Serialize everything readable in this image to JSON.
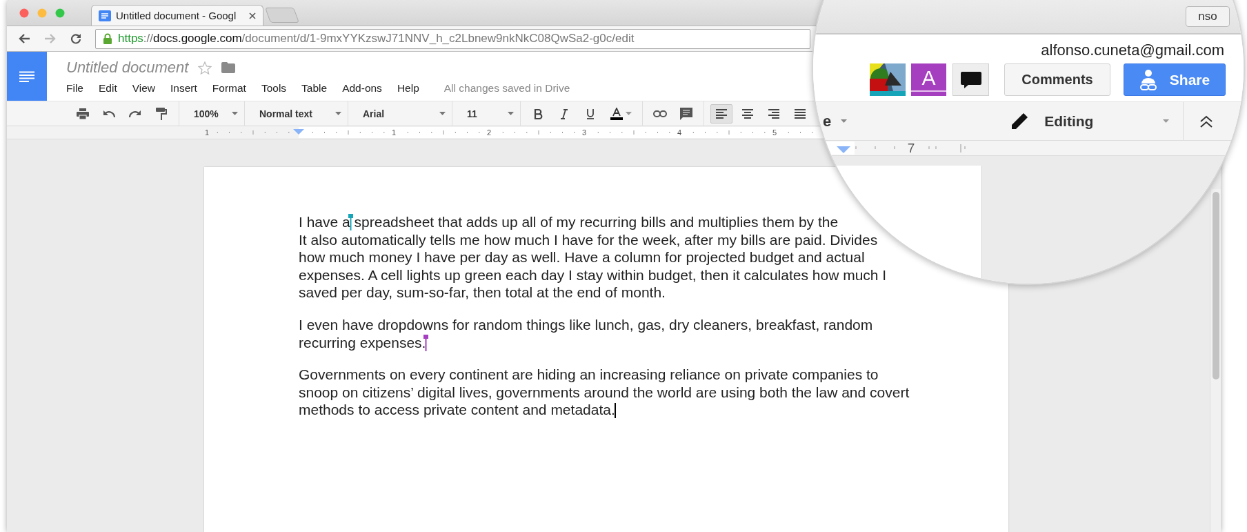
{
  "browser": {
    "tabs": [
      {
        "title": "Untitled document - Googl",
        "selected": true
      }
    ],
    "address": {
      "scheme": "https",
      "separator": "://",
      "host": "docs.google.com",
      "path": "/document/d/1-9mxYYKzswJ71NNV_h_c2Lbnew9nkNkC08QwSa2-g0c/edit"
    },
    "profile": "nso"
  },
  "docs": {
    "title": "Untitled document",
    "starred": false,
    "menu": [
      "File",
      "Edit",
      "View",
      "Insert",
      "Format",
      "Tools",
      "Table",
      "Add-ons",
      "Help"
    ],
    "save_status": "All changes saved in Drive",
    "account": "alfonso.cuneta@gmail.com",
    "collaborators": [
      {
        "kind": "photo",
        "color": "#16a5b8"
      },
      {
        "kind": "letter",
        "initial": "A",
        "color": "#a53fbf"
      }
    ],
    "comments_button": "Comments",
    "share_button": "Share"
  },
  "toolbar": {
    "zoom": "100%",
    "style": "Normal text",
    "font": "Arial",
    "size": "11",
    "alignments": [
      {
        "selected": true
      },
      {
        "selected": false
      },
      {
        "selected": false
      },
      {
        "selected": false
      }
    ],
    "partial_label": "e",
    "mode": "Editing"
  },
  "ruler": {
    "numbers": [
      "1",
      "1",
      "2",
      "3",
      "4",
      "5"
    ],
    "lens_number": "7"
  },
  "document": {
    "paragraphs": [
      {
        "runs": [
          {
            "kind": "text",
            "text": "I have a"
          },
          {
            "kind": "collaborator_cursor",
            "color": "#16a5b8"
          },
          {
            "kind": "text",
            "text": " spreadsheet that adds up all of my recurring bills and multiplies them by the\nIt also automatically tells me how much I have for the week, after my bills are paid. Divides\nhow much money I have per day as well. Have a column for projected budget and actual\nexpenses. A cell lights up green each day I stay within budget, then it calculates how much I\nsaved per day, sum-so-far, then total at the end of month."
          }
        ]
      },
      {
        "runs": [
          {
            "kind": "text",
            "text": "I even have dropdowns for random things like lunch, gas, dry cleaners, breakfast, random\nrecurring expenses."
          },
          {
            "kind": "collaborator_cursor",
            "color": "#a53fbf"
          }
        ]
      },
      {
        "runs": [
          {
            "kind": "text",
            "text": "Governments on every continent are hiding an increasing reliance on private companies to\nsnoop on citizens’ digital lives, governments around the world are using both the law and covert\nmethods to access private content and metadata."
          },
          {
            "kind": "caret",
            "color": "#000000"
          }
        ]
      }
    ]
  }
}
